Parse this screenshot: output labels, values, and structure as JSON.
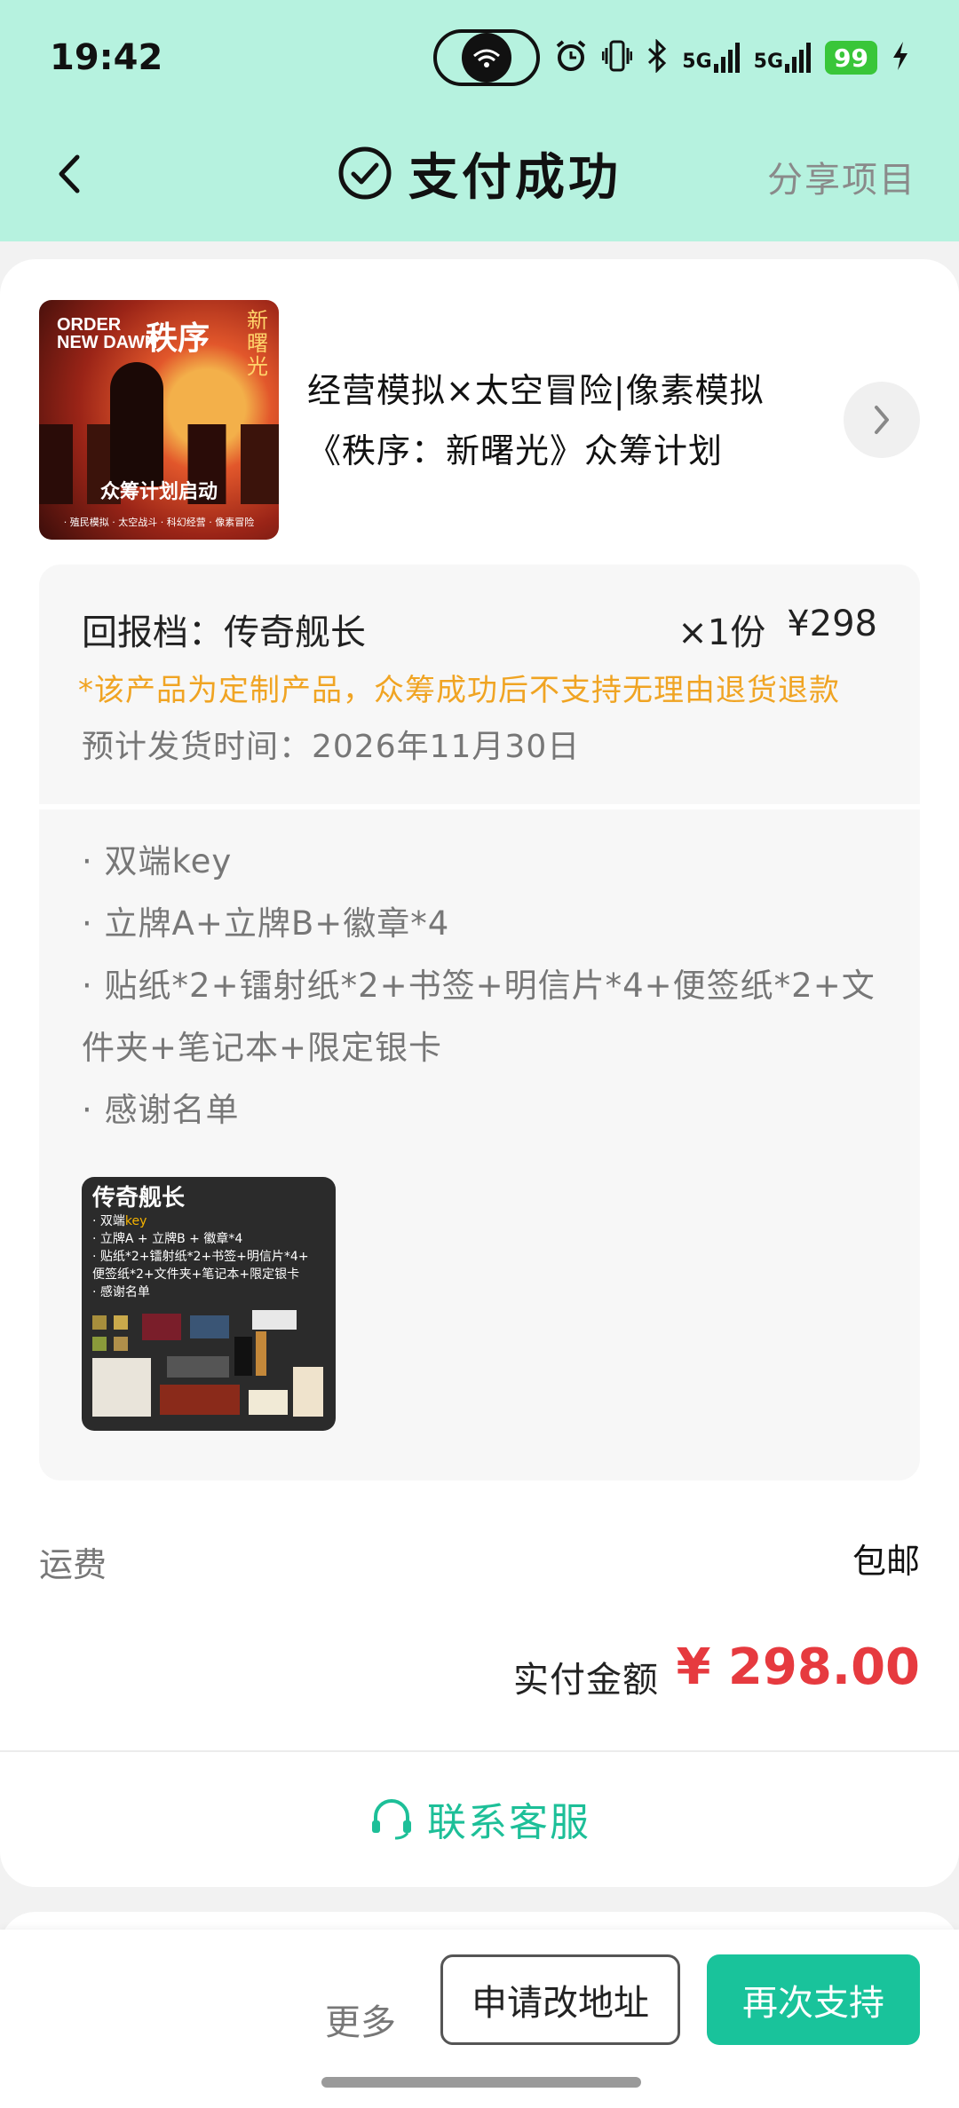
{
  "status_bar": {
    "time": "19:42",
    "battery": "99",
    "network_1": "5G",
    "network_2": "5G"
  },
  "header": {
    "title": "支付成功",
    "share": "分享项目",
    "back_icon": "chevron-left-icon",
    "success_icon": "check-circle-icon"
  },
  "product": {
    "title": "经营模拟×太空冒险|像素模拟《秩序：新曙光》众筹计划",
    "thumb": {
      "en_line1": "ORDER",
      "en_line2": "NEW DAWN",
      "cn_title": "秩序",
      "cn_sub": "新曙光",
      "banner": "众筹计划启动",
      "tags": "· 殖民模拟 · 太空战斗 · 科幻经营 · 像素冒险"
    }
  },
  "reward": {
    "name": "回报档：传奇舰长",
    "qty": "×1份",
    "price": "¥298",
    "warning": "*该产品为定制产品，众筹成功后不支持无理由退货退款",
    "ship_time": "预计发货时间：2026年11月30日",
    "items": [
      "· 双端key",
      "· 立牌A+立牌B+徽章*4",
      "· 贴纸*2+镭射纸*2+书签+明信片*4+便签纸*2+文件夹+笔记本+限定银卡",
      "· 感谢名单"
    ],
    "image": {
      "title": "传奇舰长",
      "line1_a": "· 双端",
      "line1_b": "key",
      "line2": "· 立牌A + 立牌B + 徽章*4",
      "line3": "· 贴纸*2+镭射纸*2+书签+明信片*4+",
      "line4": "便签纸*2+文件夹+笔记本+限定银卡",
      "line5": "· 感谢名单"
    }
  },
  "shipping": {
    "label": "运费",
    "value": "包邮"
  },
  "total": {
    "label": "实付金额",
    "value": "¥ 298.00"
  },
  "customer_service": {
    "label": "联系客服",
    "icon": "headset-icon"
  },
  "actions": {
    "more": "更多",
    "change_address": "申请改地址",
    "support_again": "再次支持"
  },
  "colors": {
    "header_bg": "#b6f2df",
    "accent": "#19c39b",
    "price": "#e63a3f",
    "warning": "#f0a423"
  }
}
